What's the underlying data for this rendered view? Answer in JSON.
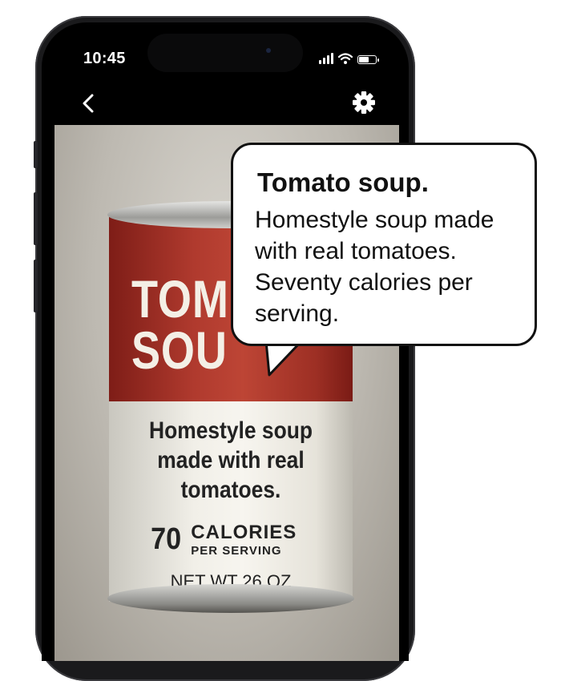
{
  "status_bar": {
    "time": "10:45"
  },
  "nav": {
    "back_icon": "chevron-left-icon",
    "settings_icon": "gear-icon"
  },
  "can": {
    "title_line1": "TOM",
    "title_line2": "SOU",
    "desc_line1": "Homestyle soup",
    "desc_line2": "made with real",
    "desc_line3": "tomatoes.",
    "calories_number": "70",
    "calories_word": "CALORIES",
    "calories_sub": "PER SERVING",
    "net_weight": "NET WT 26 OZ"
  },
  "bubble": {
    "title": "Tomato soup.",
    "line1": "Homestyle soup made",
    "line2": "with real tomatoes.",
    "line3": "Seventy calories per",
    "line4": "serving."
  },
  "colors": {
    "can_red": "#b03a2e",
    "can_white": "#f1efe8",
    "bubble_border": "#111111"
  }
}
